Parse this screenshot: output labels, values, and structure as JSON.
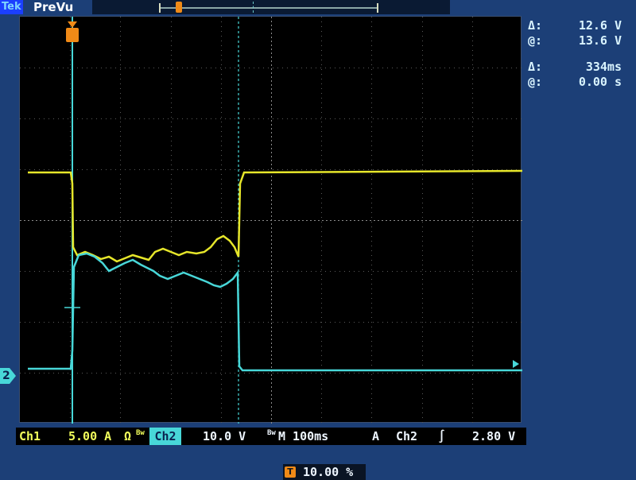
{
  "header": {
    "brand": "Tek",
    "status": "PreVu"
  },
  "cursor_readouts": [
    {
      "symbol": "Δ:",
      "value": "12.6 V"
    },
    {
      "symbol": "@:",
      "value": "13.6 V"
    },
    {
      "symbol": "Δ:",
      "value": "334ms"
    },
    {
      "symbol": "@:",
      "value": "0.00 s"
    }
  ],
  "ground_marker": {
    "label": "2"
  },
  "status_bar": {
    "ch1_label": "Ch1",
    "ch1_scale": "5.00 A",
    "ch1_units": "Ω",
    "ch1_bw": "Bw",
    "ch2_label": "Ch2",
    "ch2_scale": "10.0 V",
    "ch2_bw": "Bw",
    "timebase": "M 100ms",
    "trigger_mode": "A",
    "trigger_source": "Ch2",
    "trigger_slope_symbol": "∫",
    "trigger_level": "2.80 V"
  },
  "trigger_position": {
    "icon": "T",
    "value": "10.00 %"
  },
  "colors": {
    "ch1": "#e6e62a",
    "ch2": "#48d7d8",
    "background": "#1c3f77",
    "graticule": "#000000"
  }
}
